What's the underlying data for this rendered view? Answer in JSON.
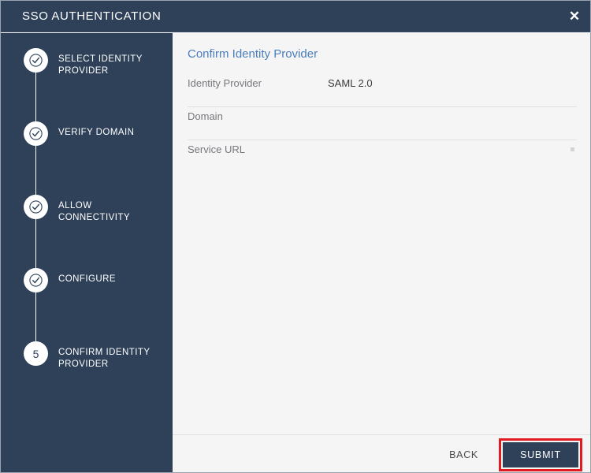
{
  "window": {
    "title": "SSO AUTHENTICATION",
    "close_icon": "close-icon",
    "close_glyph": "✕"
  },
  "theme": {
    "titlebar_bg": "#2f4159",
    "sidebar_bg": "#2f4159",
    "content_bg": "#f5f5f6",
    "heading_color": "#4a7ebb",
    "accent_highlight": "#e01b22",
    "primary_button_bg": "#2f4159"
  },
  "stepper": {
    "active_step_number": "5",
    "items": [
      {
        "label": "SELECT IDENTITY PROVIDER",
        "state": "complete",
        "icon": "check-icon"
      },
      {
        "label": "VERIFY DOMAIN",
        "state": "complete",
        "icon": "check-icon"
      },
      {
        "label": "ALLOW CONNECTIVITY",
        "state": "complete",
        "icon": "check-icon"
      },
      {
        "label": "CONFIGURE",
        "state": "complete",
        "icon": "check-icon"
      },
      {
        "label": "CONFIRM IDENTITY PROVIDER",
        "state": "active",
        "number": "5"
      }
    ]
  },
  "main": {
    "heading": "Confirm Identity Provider",
    "rows": [
      {
        "label": "Identity Provider",
        "value": "SAML 2.0"
      },
      {
        "label": "Domain",
        "value": ""
      },
      {
        "label": "Service URL",
        "value": ""
      }
    ]
  },
  "footer": {
    "back_label": "BACK",
    "submit_label": "SUBMIT"
  }
}
